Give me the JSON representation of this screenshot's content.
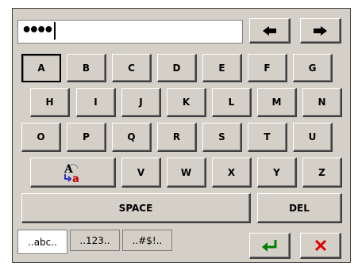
{
  "input": {
    "value": "••••"
  },
  "keys": {
    "row1": [
      "A",
      "B",
      "C",
      "D",
      "E",
      "F",
      "G"
    ],
    "row2": [
      "H",
      "I",
      "J",
      "K",
      "L",
      "M",
      "N"
    ],
    "row3": [
      "O",
      "P",
      "Q",
      "R",
      "S",
      "T",
      "U"
    ],
    "row4": [
      "V",
      "W",
      "X",
      "Y",
      "Z"
    ],
    "space": "SPACE",
    "del": "DEL"
  },
  "tabs": [
    "..abc..",
    "..123..",
    "..#$!.."
  ],
  "icons": {
    "left": "left-arrow-icon",
    "right": "right-arrow-icon",
    "shift": "case-toggle-icon",
    "enter": "enter-icon",
    "cancel": "cancel-icon"
  },
  "colors": {
    "enter": "#008000",
    "cancel": "#e00000",
    "shift_a": "#c00000",
    "shift_arrow": "#0000c0"
  }
}
